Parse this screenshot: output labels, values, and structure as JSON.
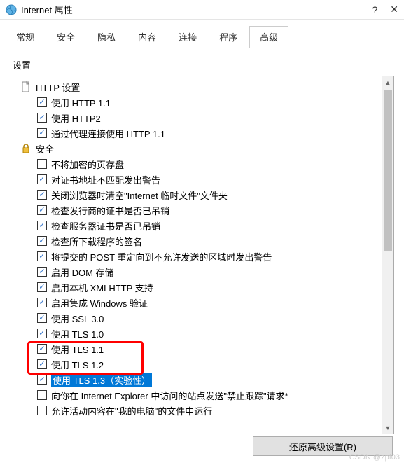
{
  "titlebar": {
    "title": "Internet 属性",
    "help": "?",
    "close": "✕"
  },
  "tabs": [
    "常规",
    "安全",
    "隐私",
    "内容",
    "连接",
    "程序",
    "高级"
  ],
  "activeTab": 6,
  "sectionLabel": "设置",
  "tree": [
    {
      "depth": 0,
      "type": "doc",
      "label": "HTTP 设置"
    },
    {
      "depth": 1,
      "type": "check",
      "checked": true,
      "label": "使用 HTTP 1.1"
    },
    {
      "depth": 1,
      "type": "check",
      "checked": true,
      "label": "使用 HTTP2"
    },
    {
      "depth": 1,
      "type": "check",
      "checked": true,
      "label": "通过代理连接使用 HTTP 1.1"
    },
    {
      "depth": 0,
      "type": "lock",
      "label": "安全"
    },
    {
      "depth": 1,
      "type": "check",
      "checked": false,
      "label": "不将加密的页存盘"
    },
    {
      "depth": 1,
      "type": "check",
      "checked": true,
      "label": "对证书地址不匹配发出警告"
    },
    {
      "depth": 1,
      "type": "check",
      "checked": true,
      "label": "关闭浏览器时清空\"Internet 临时文件\"文件夹"
    },
    {
      "depth": 1,
      "type": "check",
      "checked": true,
      "label": "检查发行商的证书是否已吊销"
    },
    {
      "depth": 1,
      "type": "check",
      "checked": true,
      "label": "检查服务器证书是否已吊销"
    },
    {
      "depth": 1,
      "type": "check",
      "checked": true,
      "label": "检查所下载程序的签名"
    },
    {
      "depth": 1,
      "type": "check",
      "checked": true,
      "label": "将提交的 POST 重定向到不允许发送的区域时发出警告"
    },
    {
      "depth": 1,
      "type": "check",
      "checked": true,
      "label": "启用 DOM 存储"
    },
    {
      "depth": 1,
      "type": "check",
      "checked": true,
      "label": "启用本机 XMLHTTP 支持"
    },
    {
      "depth": 1,
      "type": "check",
      "checked": true,
      "label": "启用集成 Windows 验证"
    },
    {
      "depth": 1,
      "type": "check",
      "checked": true,
      "label": "使用 SSL 3.0"
    },
    {
      "depth": 1,
      "type": "check",
      "checked": true,
      "label": "使用 TLS 1.0"
    },
    {
      "depth": 1,
      "type": "check",
      "checked": true,
      "label": "使用 TLS 1.1"
    },
    {
      "depth": 1,
      "type": "check",
      "checked": true,
      "label": "使用 TLS 1.2"
    },
    {
      "depth": 1,
      "type": "check",
      "checked": true,
      "label": "使用 TLS 1.3（实验性）",
      "selected": true
    },
    {
      "depth": 1,
      "type": "check",
      "checked": false,
      "label": "向你在 Internet Explorer 中访问的站点发送\"禁止跟踪\"请求*"
    },
    {
      "depth": 1,
      "type": "check",
      "checked": false,
      "label": "允许活动内容在\"我的电脑\"的文件中运行"
    }
  ],
  "restoreButton": "还原高级设置(R)",
  "watermark": "CSDN @zpf03"
}
